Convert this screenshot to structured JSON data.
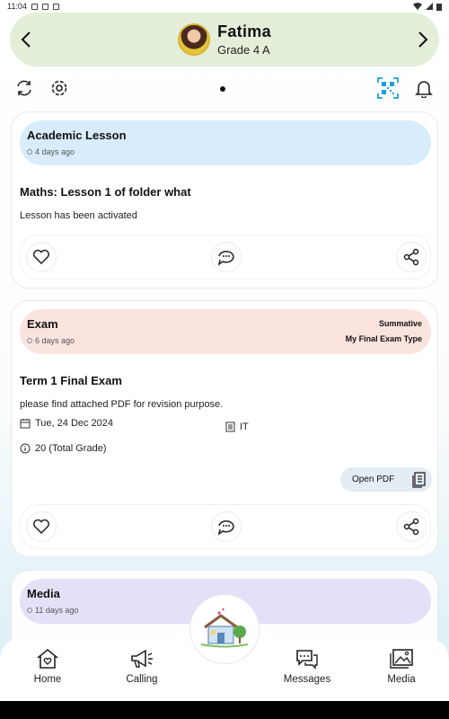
{
  "status_bar": {
    "time": "11:04"
  },
  "header": {
    "student_name": "Fatima",
    "grade": "Grade 4 A",
    "colors": {
      "background": "#e3efd8"
    }
  },
  "toolbar": {
    "icons": [
      "refresh-icon",
      "settings-icon",
      "qr-code-icon",
      "bell-icon"
    ],
    "accent": "#1aa3d6"
  },
  "cards": [
    {
      "type": "Academic Lesson",
      "time": "4 days ago",
      "title": "Maths: Lesson 1 of folder what",
      "body": "Lesson has been activated",
      "header_color": "#d8ecfb"
    },
    {
      "type": "Exam",
      "time": "6 days ago",
      "tag1": "Summative",
      "tag2": "My Final Exam Type",
      "title": "Term 1 Final Exam",
      "body": "please find attached PDF for revision purpose.",
      "date": "Tue, 24 Dec 2024",
      "subject": "IT",
      "grade_total": "20 (Total Grade)",
      "pdf_button": "Open PDF",
      "header_color": "#fbe3de"
    },
    {
      "type": "Media",
      "time": "11 days ago",
      "header_color": "#e2e1f8"
    }
  ],
  "bottom_nav": {
    "items": [
      {
        "label": "Home",
        "icon": "home-heart-icon"
      },
      {
        "label": "Calling",
        "icon": "megaphone-icon"
      },
      {
        "label": "Messages",
        "icon": "chat-bubbles-icon"
      },
      {
        "label": "Media",
        "icon": "gallery-icon"
      }
    ],
    "center": "school-house-icon"
  }
}
